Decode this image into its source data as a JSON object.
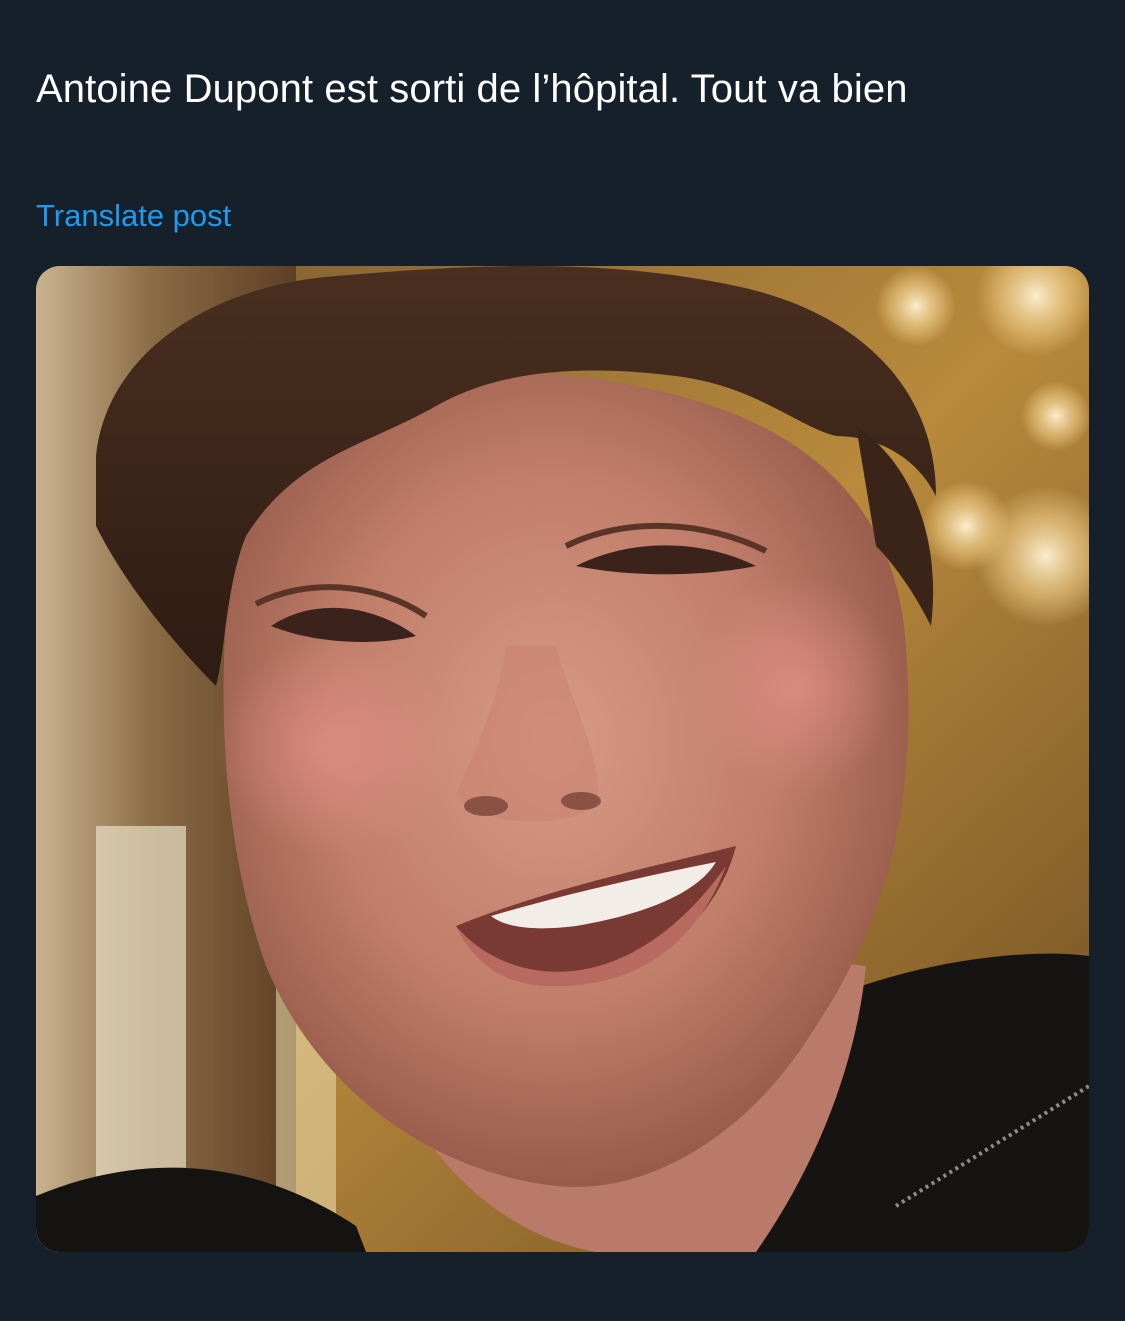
{
  "post": {
    "text": "Antoine Dupont est sorti de l’hôpital. Tout va bien",
    "translate_label": "Translate post"
  },
  "media": {
    "type": "photo"
  },
  "colors": {
    "background": "#15202b",
    "text": "#ffffff",
    "link": "#1d9bf0"
  }
}
